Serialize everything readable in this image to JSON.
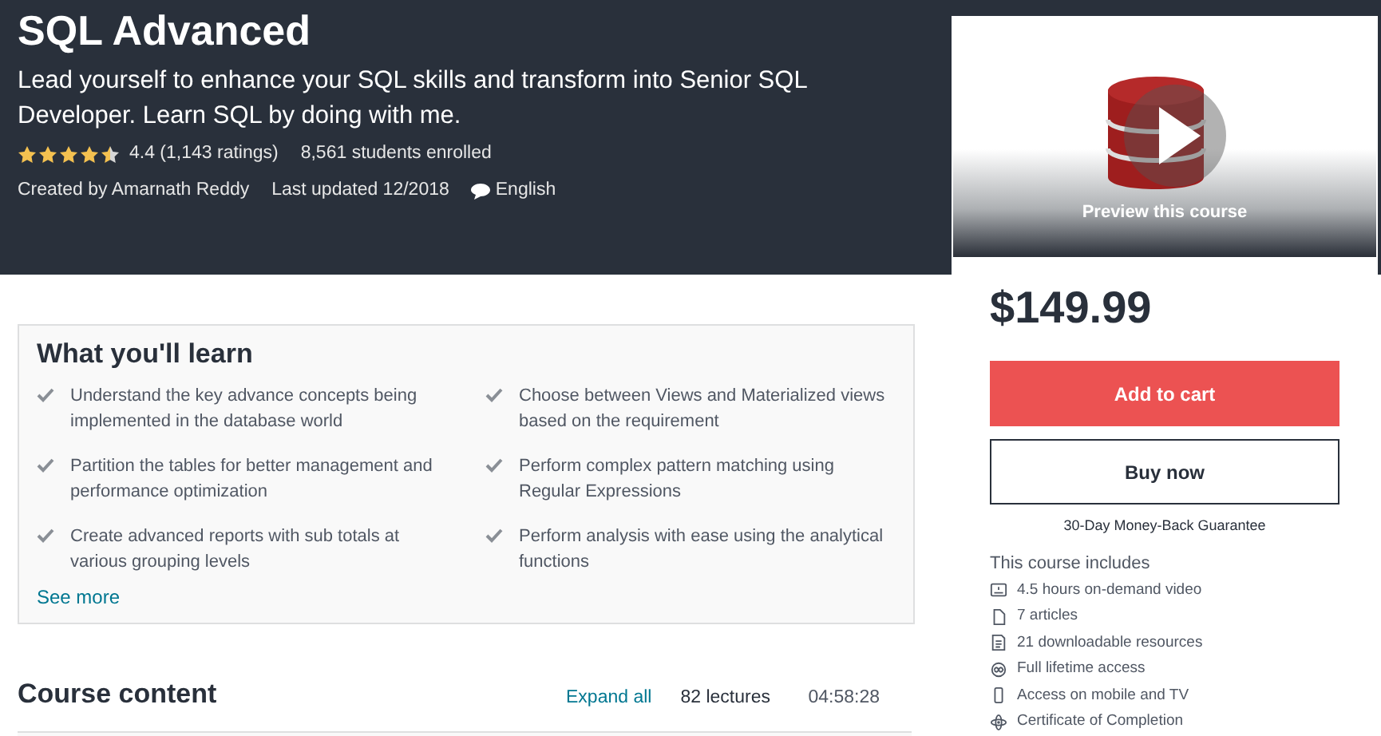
{
  "course": {
    "title": "SQL Advanced",
    "subtitle": "Lead yourself to enhance your SQL skills and transform into Senior SQL Developer. Learn SQL by doing with me.",
    "stars": 4.5,
    "rating": "4.4 (1,143 ratings)",
    "enrolled": "8,561 students enrolled",
    "created_by": "Created by Amarnath Reddy",
    "last_updated": "Last updated 12/2018",
    "language": "English"
  },
  "learn": {
    "title": "What you'll learn",
    "items": [
      "Understand the key advance concepts being implemented in the database world",
      "Choose between Views and Materialized views based on the requirement",
      "Partition the tables for better management and performance optimization",
      "Perform complex pattern matching using Regular Expressions",
      "Create advanced reports with sub totals at various grouping levels",
      "Perform analysis with ease using the analytical functions"
    ],
    "see_more": "See more"
  },
  "content": {
    "title": "Course content",
    "expand": "Expand all",
    "lectures": "82 lectures",
    "duration": "04:58:28"
  },
  "sidebar": {
    "preview": "Preview this course",
    "price": "$149.99",
    "add_to_cart": "Add to cart",
    "buy_now": "Buy now",
    "guarantee": "30-Day Money-Back Guarantee",
    "includes_title": "This course includes",
    "includes": [
      {
        "kind": "video",
        "text": "4.5 hours on-demand video"
      },
      {
        "kind": "article",
        "text": "7 articles"
      },
      {
        "kind": "resource",
        "text": "21 downloadable resources"
      },
      {
        "kind": "lifetime",
        "text": "Full lifetime access"
      },
      {
        "kind": "mobile",
        "text": "Access on mobile and TV"
      },
      {
        "kind": "certificate",
        "text": "Certificate of Completion"
      }
    ]
  }
}
